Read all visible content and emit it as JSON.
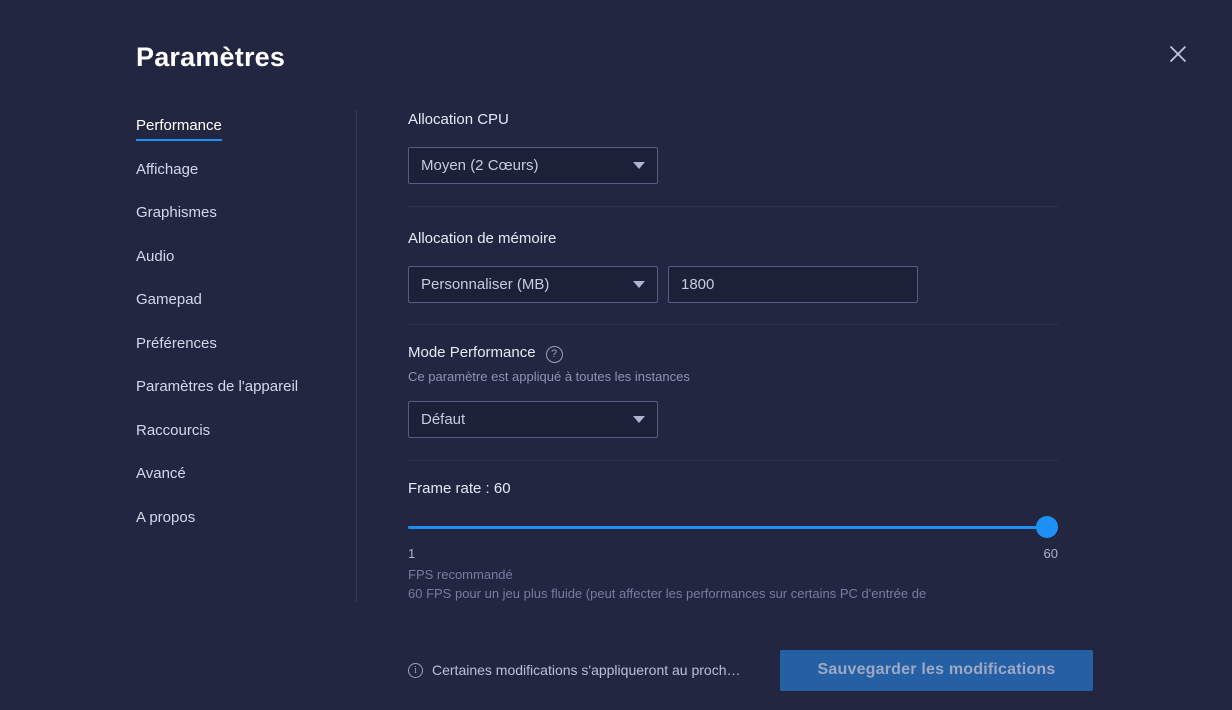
{
  "header": {
    "title": "Paramètres",
    "close_label": "×"
  },
  "sidebar": {
    "items": [
      {
        "label": "Performance",
        "active": true
      },
      {
        "label": "Affichage",
        "active": false
      },
      {
        "label": "Graphismes",
        "active": false
      },
      {
        "label": "Audio",
        "active": false
      },
      {
        "label": "Gamepad",
        "active": false
      },
      {
        "label": "Préférences",
        "active": false
      },
      {
        "label": "Paramètres de l'appareil",
        "active": false
      },
      {
        "label": "Raccourcis",
        "active": false
      },
      {
        "label": "Avancé",
        "active": false
      },
      {
        "label": "A propos",
        "active": false
      }
    ]
  },
  "main": {
    "cpu": {
      "label": "Allocation CPU",
      "select_value": "Moyen (2 Cœurs)"
    },
    "memory": {
      "label": "Allocation de mémoire",
      "select_value": "Personnaliser (MB)",
      "input_value": "1800"
    },
    "performance_mode": {
      "label": "Mode Performance",
      "help_icon": "?",
      "description": "Ce paramètre est appliqué à toutes les instances",
      "select_value": "Défaut"
    },
    "frame_rate": {
      "label": "Frame rate : 60",
      "value": 60,
      "min": 1,
      "max": 60,
      "min_label": "1",
      "max_label": "60",
      "hint_title": "FPS recommandé",
      "hint_body": "60 FPS pour un jeu plus fluide (peut affecter les performances sur certains PC d'entrée de"
    }
  },
  "footer": {
    "info_icon": "i",
    "note": "Certaines modifications s'appliqueront au proch…",
    "save_label": "Sauvegarder les modifications"
  },
  "colors": {
    "background": "#222640",
    "accent": "#1e90f5",
    "save_button": "#2560a5",
    "control_fill": "#1d2039",
    "control_border": "#565d80"
  }
}
